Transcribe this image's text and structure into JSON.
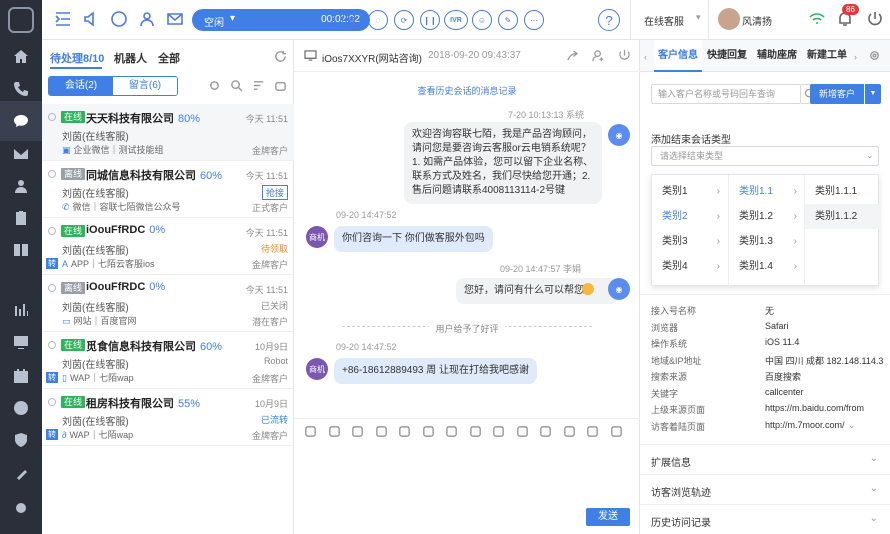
{
  "toolbar": {
    "status": "空闲",
    "timer": "00:02:02",
    "ivr": "IVR",
    "agent_state": "在线客服",
    "agent_name": "风清扬",
    "notify_count": "86"
  },
  "list": {
    "tabs": [
      "待处理8/10",
      "机器人",
      "全部"
    ],
    "seg": [
      "会话(2)",
      "留言(6)"
    ],
    "items": [
      {
        "status": "在线",
        "name": "天天科技有限公司",
        "pct": "80%",
        "time": "今天 11:51",
        "agent": "刘茵(在线客服)",
        "state": "",
        "channel": "企业微信｜测试技能组",
        "type": "金牌客户"
      },
      {
        "status": "离线",
        "name": "同城信息科技有限公司",
        "pct": "60%",
        "time": "今天 11:51",
        "agent": "刘茵(在线客服)",
        "state": "抢接",
        "channel": "微信｜容联七陌微信公众号",
        "type": "正式客户"
      },
      {
        "status": "在线",
        "name": "iOouFfRDC",
        "pct": "0%",
        "time": "今天 11:51",
        "agent": "刘茵(在线客服)",
        "state": "待领取",
        "channel": "APP｜七陌云客服ios",
        "type": "金牌客户"
      },
      {
        "status": "离线",
        "name": "iOouFfRDC",
        "pct": "0%",
        "time": "今天 11:51",
        "agent": "刘茵(在线客服)",
        "state": "已关闭",
        "channel": "网站｜百度官网",
        "type": "潜在客户"
      },
      {
        "status": "在线",
        "name": "觅食信息科技有限公司",
        "pct": "60%",
        "time": "10月9日",
        "agent": "刘茵(在线客服)",
        "state": "Robot",
        "channel": "WAP｜七陌wap",
        "type": "金牌客户"
      },
      {
        "status": "在线",
        "name": "租房科技有限公司",
        "pct": "55%",
        "time": "10月9日",
        "agent": "刘茵(在线客服)",
        "state": "已流转",
        "channel": "WAP｜七陌wap",
        "type": "金牌客户"
      }
    ],
    "zhuan": "转"
  },
  "chat": {
    "title": "iOos7XXYR(网站咨询)",
    "date": "2018-09-20 09:43:37",
    "history": "查看历史会话的消息记录",
    "messages": [
      {
        "meta": "7-20  10:13:13  系统",
        "text": "欢迎咨询容联七陌，我是产品咨询顾问，请问您是要咨询云客服or云电销系统呢？1. 如需产品体验，您可以留下企业名称、联系方式及姓名，我们尽快给您开通；2. 售后问题请联系4008113114-2号键"
      },
      {
        "meta": "09-20 14:47:52",
        "text": "你们咨询一下 你们做客服外包吗",
        "avatar": "商机"
      },
      {
        "meta": "09-20 14:47:57 李娟",
        "text": "您好，请问有什么可以帮您？"
      },
      {
        "meta": "09-20 14:47:52",
        "text": "+86-18612889493 周 让现在打给我吧感谢",
        "avatar": "商机"
      }
    ],
    "rating": "用户给予了好评",
    "send": "发送"
  },
  "right": {
    "tabs": [
      "客户信息",
      "快捷回复",
      "辅助座席",
      "新建工单"
    ],
    "search_placeholder": "输入客户名称或号码回车查询",
    "new_customer": "新增客户",
    "end_label": "添加结束会话类型",
    "end_placeholder": "请选择结束类型",
    "cascade": {
      "col1": [
        "类别1",
        "类别2",
        "类别3",
        "类别4"
      ],
      "col2": [
        "类别1.1",
        "类别1.2",
        "类别1.3",
        "类别1.4"
      ],
      "col3": [
        "类别1.1.1",
        "类别1.1.2"
      ]
    },
    "info": [
      {
        "k": "接入号名称",
        "v": "无"
      },
      {
        "k": "浏览器",
        "v": "Safari"
      },
      {
        "k": "操作系统",
        "v": "iOS 11.4"
      },
      {
        "k": "地域&IP地址",
        "v": "中国 四川 成都 182.148.114.3"
      },
      {
        "k": "搜索来源",
        "v": "百度搜索"
      },
      {
        "k": "关键字",
        "v": "callcenter"
      },
      {
        "k": "上级来源页面",
        "v": "https://m.baidu.com/from"
      },
      {
        "k": "访客着陆页面",
        "v": "http://m.7moor.com/"
      }
    ],
    "sections": [
      "扩展信息",
      "访客浏览轨迹",
      "历史访问记录"
    ]
  }
}
